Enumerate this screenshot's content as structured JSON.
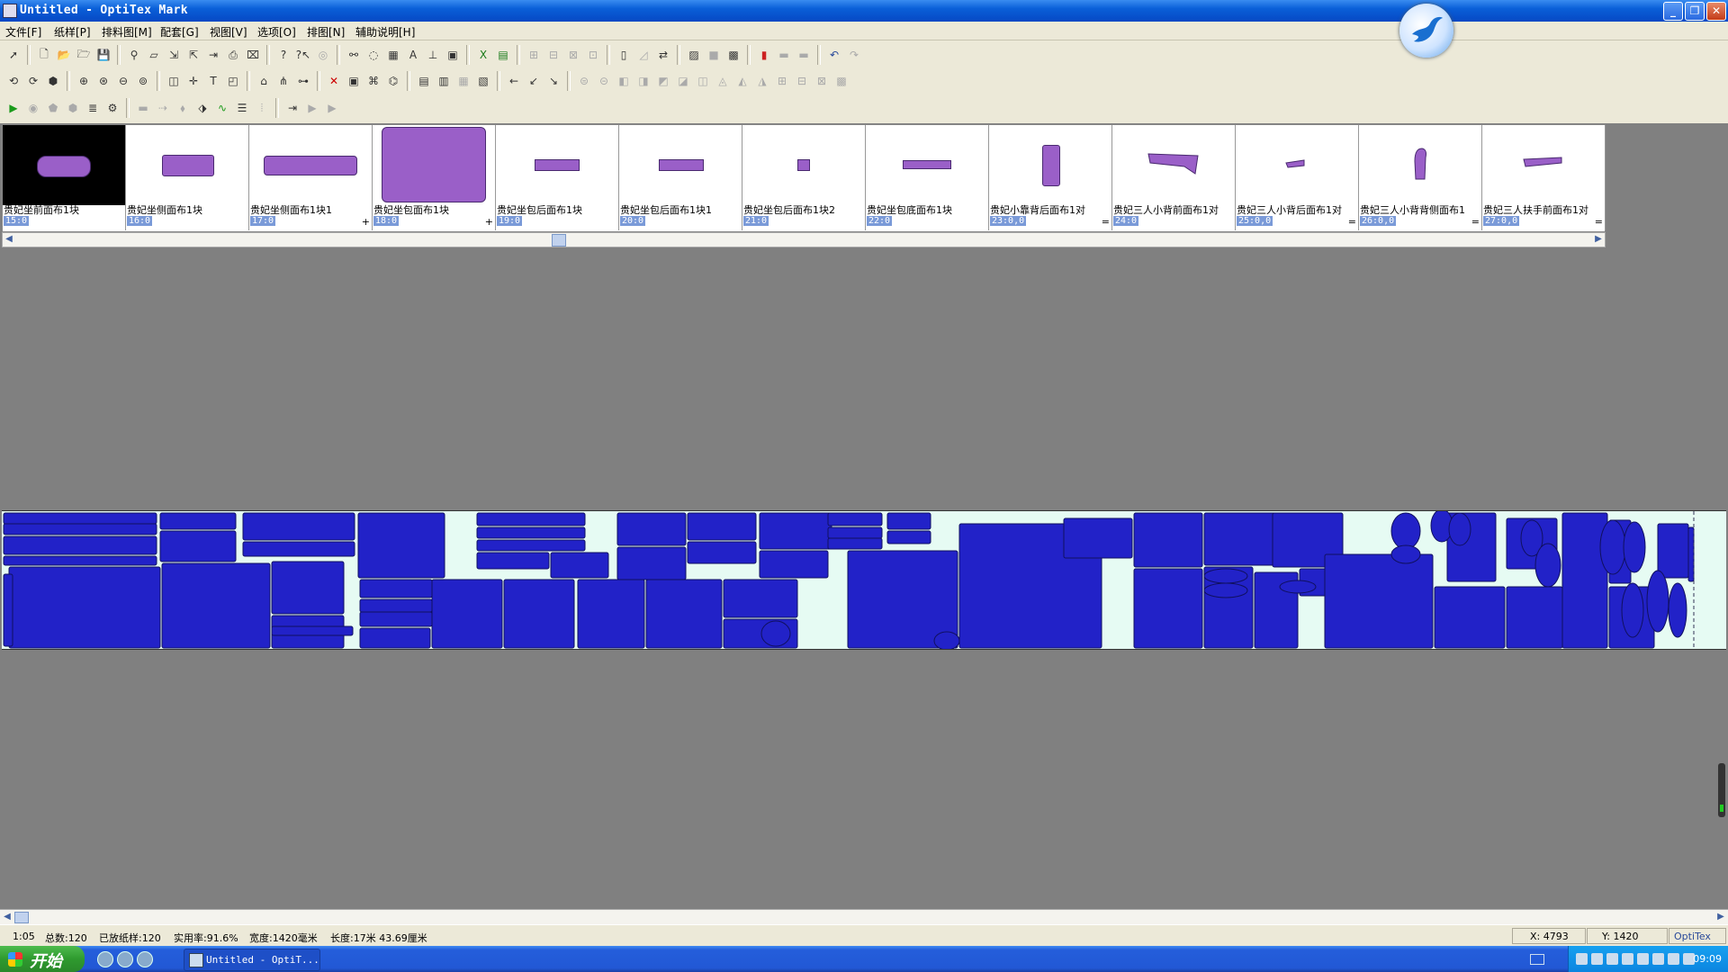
{
  "window": {
    "title": "Untitled - OptiTex Mark",
    "minimize": "_",
    "maximize": "❐",
    "close": "✕"
  },
  "menu": [
    "文件[F]",
    "纸样[P]",
    "排料图[M]",
    "配套[G]",
    "视图[V]",
    "选项[O]",
    "排图[N]",
    "辅助说明[H]"
  ],
  "pieces": [
    {
      "name": "贵妃坐前面布1块",
      "count": "15:0",
      "mark": "",
      "selected": true
    },
    {
      "name": "贵妃坐侧面布1块",
      "count": "16:0",
      "mark": ""
    },
    {
      "name": "贵妃坐侧面布1块1",
      "count": "17:0",
      "mark": "+"
    },
    {
      "name": "贵妃坐包面布1块",
      "count": "18:0",
      "mark": "+"
    },
    {
      "name": "贵妃坐包后面布1块",
      "count": "19:0",
      "mark": ""
    },
    {
      "name": "贵妃坐包后面布1块1",
      "count": "20:0",
      "mark": ""
    },
    {
      "name": "贵妃坐包后面布1块2",
      "count": "21:0",
      "mark": ""
    },
    {
      "name": "贵妃坐包底面布1块",
      "count": "22:0",
      "mark": ""
    },
    {
      "name": "贵妃小靠背后面布1对",
      "count": "23:0,0",
      "mark": "="
    },
    {
      "name": "贵妃三人小背前面布1对",
      "count": "24:0",
      "mark": ""
    },
    {
      "name": "贵妃三人小背后面布1对",
      "count": "25:0,0",
      "mark": "="
    },
    {
      "name": "贵妃三人小背背侧面布1",
      "count": "26:0,0",
      "mark": "="
    },
    {
      "name": "贵妃三人扶手前面布1对",
      "count": "27:0,0",
      "mark": "="
    }
  ],
  "status": {
    "scale": "1:05",
    "total": "总数:120",
    "placed": "已放纸样:120",
    "efficiency": "实用率:91.6%",
    "width": "宽度:1420毫米",
    "length": "长度:17米 43.69厘米",
    "x": "X: 4793",
    "y": "Y: 1420",
    "brand": "OptiTex"
  },
  "taskbar": {
    "start": "开始",
    "task": "Untitled - OptiT...",
    "clock": "09:09"
  },
  "colors": {
    "piece_fill": "#9a5fc8",
    "marker_piece": "#2222c8",
    "marker_bg": "#e6fbf3",
    "workspace": "#808080"
  }
}
